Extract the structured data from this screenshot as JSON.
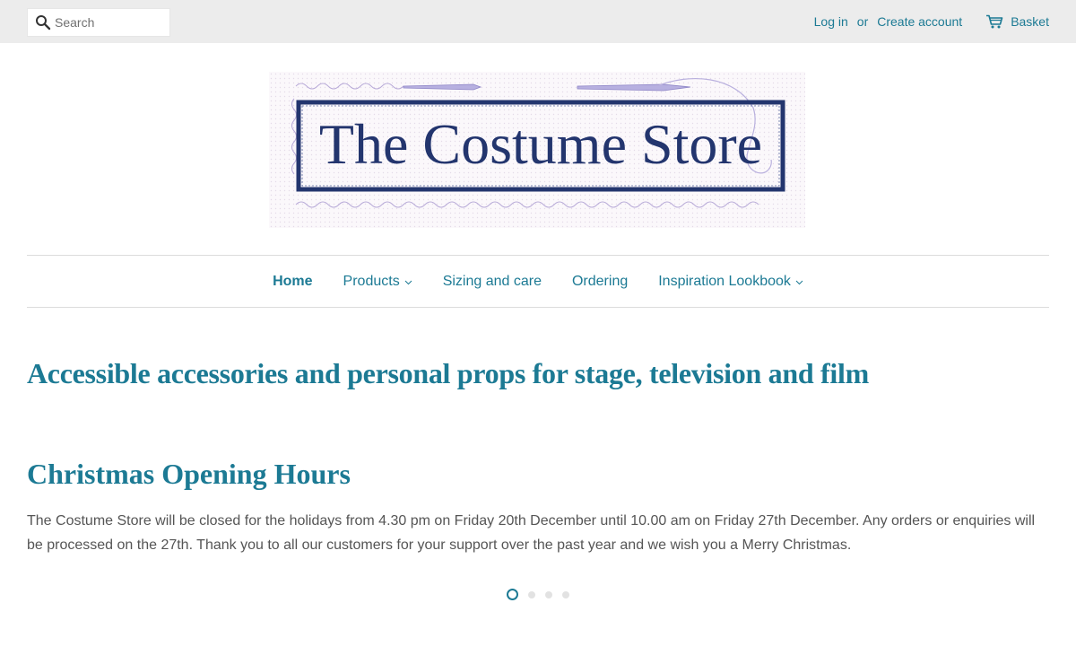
{
  "header": {
    "search_placeholder": "Search",
    "login_label": "Log in",
    "or_label": "or",
    "create_account_label": "Create account",
    "basket_label": "Basket"
  },
  "logo": {
    "text": "The Costume Store"
  },
  "nav": {
    "items": [
      {
        "label": "Home",
        "active": true
      },
      {
        "label": "Products",
        "dropdown": true
      },
      {
        "label": "Sizing and care"
      },
      {
        "label": "Ordering"
      },
      {
        "label": "Inspiration Lookbook",
        "dropdown": true
      }
    ]
  },
  "main": {
    "tagline": "Accessible accessories and personal props for stage, television and film",
    "slide": {
      "title": "Christmas Opening Hours",
      "body": "The Costume Store will be closed for the holidays from 4.30 pm on Friday 20th December until 10.00 am on Friday 27th December. Any orders or enquiries will be processed on the 27th. Thank you to all our customers for your support over the past year and we wish you a Merry Christmas."
    },
    "slider": {
      "count": 4,
      "active_index": 0
    }
  },
  "colors": {
    "accent": "#1c7a94",
    "logo_navy": "#23356e",
    "topbar_bg": "#ececec"
  },
  "icons": {
    "search": "search-icon",
    "cart": "cart-icon",
    "dropdown": "chevron-down-icon"
  }
}
